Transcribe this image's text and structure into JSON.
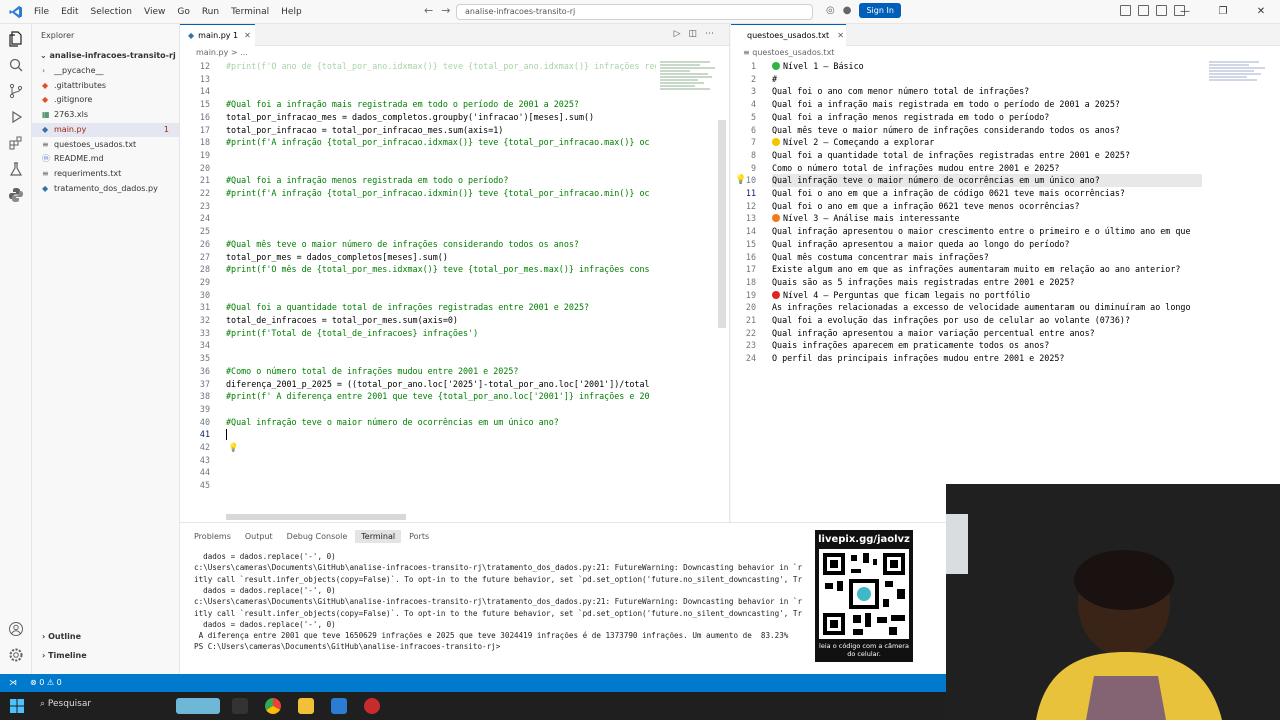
{
  "titlebar": {
    "menu": [
      "File",
      "Edit",
      "Selection",
      "View",
      "Go",
      "Run",
      "Terminal",
      "Help"
    ],
    "search": "analise-infracoes-transito-rj",
    "signin": "Sign In"
  },
  "explorer": {
    "title": "Explorer",
    "folder": "analise-infracoes-transito-rj",
    "files": [
      {
        "name": "__pycache__",
        "icon": "chevron-right-icon"
      },
      {
        "name": ".gitattributes",
        "icon": "git-icon"
      },
      {
        "name": ".gitignore",
        "icon": "git-icon"
      },
      {
        "name": "2763.xls",
        "icon": "excel-icon"
      },
      {
        "name": "main.py",
        "icon": "python-icon",
        "badge": "1"
      },
      {
        "name": "questoes_usados.txt",
        "icon": "text-file-icon"
      },
      {
        "name": "README.md",
        "icon": "markdown-icon"
      },
      {
        "name": "requeriments.txt",
        "icon": "text-file-icon"
      },
      {
        "name": "tratamento_dos_dados.py",
        "icon": "python-icon"
      }
    ],
    "outline": "Outline",
    "timeline": "Timeline"
  },
  "editor1": {
    "tab": "main.py 1",
    "breadcrumb": "main.py > ...",
    "lines": [
      {
        "n": "12",
        "t": "#print(f'O ano de {total_por_ano.idxmax()} teve {total_por_ano.idxmax()} infrações registradas')",
        "c": true
      },
      {
        "n": "13",
        "t": ""
      },
      {
        "n": "14",
        "t": ""
      },
      {
        "n": "15",
        "t": "#Qual foi a infração mais registrada em todo o período de 2001 a 2025?",
        "c": true
      },
      {
        "n": "16",
        "t": "total_por_infracao_mes = dados_completos.groupby('infracao')[meses].sum()"
      },
      {
        "n": "17",
        "t": "total_por_infracao = total_por_infracao_mes.sum(axis=1)"
      },
      {
        "n": "18",
        "t": "#print(f'A infração {total_por_infracao.idxmax()} teve {total_por_infracao.max()} oc",
        "c": true
      },
      {
        "n": "19",
        "t": ""
      },
      {
        "n": "20",
        "t": ""
      },
      {
        "n": "21",
        "t": "#Qual foi a infração menos registrada em todo o período?",
        "c": true
      },
      {
        "n": "22",
        "t": "#print(f'A infração {total_por_infracao.idxmin()} teve {total_por_infracao.min()} oc",
        "c": true
      },
      {
        "n": "23",
        "t": ""
      },
      {
        "n": "24",
        "t": ""
      },
      {
        "n": "25",
        "t": ""
      },
      {
        "n": "26",
        "t": "#Qual mês teve o maior número de infrações considerando todos os anos?",
        "c": true
      },
      {
        "n": "27",
        "t": "total_por_mes = dados_completos[meses].sum()"
      },
      {
        "n": "28",
        "t": "#print(f'O mês de {total_por_mes.idxmax()} teve {total_por_mes.max()} infrações cons",
        "c": true
      },
      {
        "n": "29",
        "t": ""
      },
      {
        "n": "30",
        "t": ""
      },
      {
        "n": "31",
        "t": "#Qual foi a quantidade total de infrações registradas entre 2001 e 2025?",
        "c": true
      },
      {
        "n": "32",
        "t": "total_de_infracoes = total_por_mes.sum(axis=0)"
      },
      {
        "n": "33",
        "t": "#print(f'Total de {total_de_infracoes} infrações')",
        "c": true
      },
      {
        "n": "34",
        "t": ""
      },
      {
        "n": "35",
        "t": ""
      },
      {
        "n": "36",
        "t": "#Como o número total de infrações mudou entre 2001 e 2025?",
        "c": true
      },
      {
        "n": "37",
        "t": "diferença_2001_p_2025 = ((total_por_ano.loc['2025']-total_por_ano.loc['2001'])/total"
      },
      {
        "n": "38",
        "t": "#print(f' A diferença entre 2001 que teve {total_por_ano.loc['2001']} infrações e 20",
        "c": true
      },
      {
        "n": "39",
        "t": ""
      },
      {
        "n": "40",
        "t": "#Qual infração teve o maior número de ocorrências em um único ano?",
        "c": true
      },
      {
        "n": "41",
        "t": "",
        "cur": true
      },
      {
        "n": "42",
        "t": ""
      },
      {
        "n": "43",
        "t": ""
      },
      {
        "n": "44",
        "t": ""
      },
      {
        "n": "45",
        "t": ""
      }
    ]
  },
  "editor2": {
    "tab": "questoes_usados.txt",
    "breadcrumb": "questoes_usados.txt",
    "lines": [
      {
        "n": "1",
        "t": "Nível 1 – Básico",
        "dot": "#2fb344"
      },
      {
        "n": "2",
        "t": "#"
      },
      {
        "n": "3",
        "t": "Qual foi o ano com menor número total de infrações?"
      },
      {
        "n": "4",
        "t": "Qual foi a infração mais registrada em todo o período de 2001 a 2025?"
      },
      {
        "n": "5",
        "t": "Qual foi a infração menos registrada em todo o período?"
      },
      {
        "n": "6",
        "t": "Qual mês teve o maior número de infrações considerando todos os anos?"
      },
      {
        "n": "7",
        "t": "Nível 2 – Começando a explorar",
        "dot": "#f5c400"
      },
      {
        "n": "8",
        "t": "Qual foi a quantidade total de infrações registradas entre 2001 e 2025?"
      },
      {
        "n": "9",
        "t": "Como o número total de infrações mudou entre 2001 e 2025?"
      },
      {
        "n": "10",
        "t": "Qual infração teve o maior número de ocorrências em um único ano?",
        "sel": true
      },
      {
        "n": "11",
        "t": "Qual foi o ano em que a infração de código 0621 teve mais ocorrências?",
        "cur": true
      },
      {
        "n": "12",
        "t": "Qual foi o ano em que a infração 0621 teve menos ocorrências?"
      },
      {
        "n": "13",
        "t": "Nível 3 – Análise mais interessante",
        "dot": "#f07a1a"
      },
      {
        "n": "14",
        "t": "Qual infração apresentou o maior crescimento entre o primeiro e o último ano em que"
      },
      {
        "n": "15",
        "t": "Qual infração apresentou a maior queda ao longo do período?"
      },
      {
        "n": "16",
        "t": "Qual mês costuma concentrar mais infrações?"
      },
      {
        "n": "17",
        "t": "Existe algum ano em que as infrações aumentaram muito em relação ao ano anterior?"
      },
      {
        "n": "18",
        "t": "Quais são as 5 infrações mais registradas entre 2001 e 2025?"
      },
      {
        "n": "19",
        "t": "Nível 4 – Perguntas que ficam legais no portfólio",
        "dot": "#e02424"
      },
      {
        "n": "20",
        "t": "As infrações relacionadas a excesso de velocidade aumentaram ou diminuíram ao longo"
      },
      {
        "n": "21",
        "t": "Qual foi a evolução das infrações por uso de celular ao volante (0736)?"
      },
      {
        "n": "22",
        "t": "Qual infração apresentou a maior variação percentual entre anos?"
      },
      {
        "n": "23",
        "t": "Quais infrações aparecem em praticamente todos os anos?"
      },
      {
        "n": "24",
        "t": "O perfil das principais infrações mudou entre 2001 e 2025?"
      }
    ]
  },
  "panel": {
    "tabs": [
      "Problems",
      "Output",
      "Debug Console",
      "Terminal",
      "Ports"
    ],
    "active": "Terminal",
    "lines": [
      "  dados = dados.replace('-', 0)",
      "c:\\Users\\cameras\\Documents\\GitHub\\analise-infracoes-transito-rj\\tratamento_dos_dados.py:21: FutureWarning: Downcasting behavior in `r",
      "itly call `result.infer_objects(copy=False)`. To opt-in to the future behavior, set `pd.set_option('future.no_silent_downcasting', Tr",
      "  dados = dados.replace('-', 0)",
      "c:\\Users\\cameras\\Documents\\GitHub\\analise-infracoes-transito-rj\\tratamento_dos_dados.py:21: FutureWarning: Downcasting behavior in `r",
      "itly call `result.infer_objects(copy=False)`. To opt-in to the future behavior, set `pd.set_option('future.no_silent_downcasting', Tr",
      "  dados = dados.replace('-', 0)",
      " A diferença entre 2001 que teve 1650629 infrações e 2025 que teve 3024419 infrações é de 1373790 infrações. Um aumento de  83.23%",
      "PS C:\\Users\\cameras\\Documents\\GitHub\\analise-infracoes-transito-rj> "
    ]
  },
  "overlay": {
    "url": "livepix.gg/jaolvz",
    "caption": "leia o código com a câmera do celular."
  },
  "status": {
    "errors": "⊗ 0 ⚠ 0"
  },
  "taskbar": {
    "search": "Pesquisar"
  }
}
